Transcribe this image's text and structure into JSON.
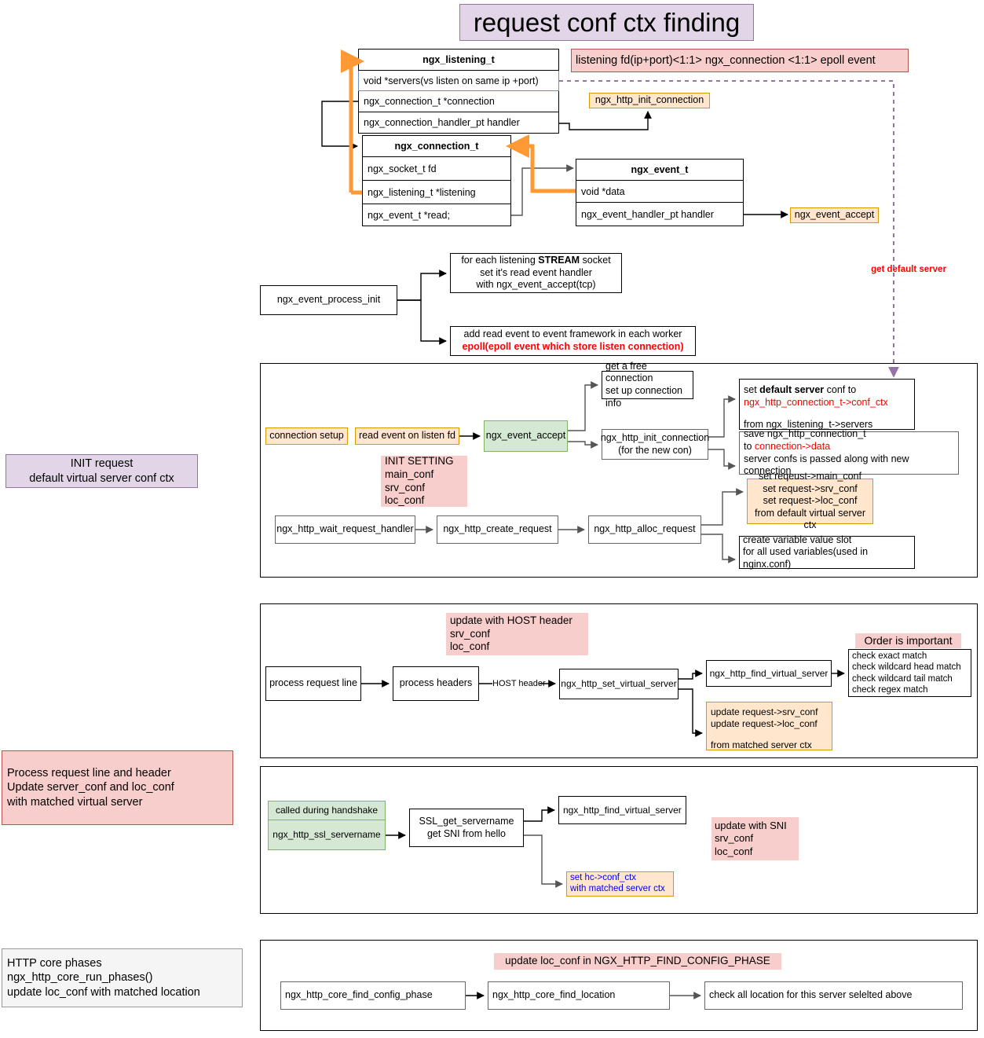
{
  "title": "request conf ctx finding",
  "banners": {
    "listening_relation": "listening fd(ip+port)<1:1> ngx_connection <1:1> epoll event",
    "get_default_server": "get default server"
  },
  "structs": [
    {
      "name": "ngx_listening_t",
      "fields": [
        "void      *servers(vs listen on same ip +port)",
        "ngx_connection_t   *connection",
        "ngx_connection_handler_pt   handler"
      ]
    },
    {
      "name": "ngx_connection_t",
      "fields": [
        "ngx_socket_t        fd",
        "ngx_listening_t   *listening",
        "ngx_event_t        *read;"
      ]
    },
    {
      "name": "ngx_event_t",
      "fields": [
        "void             *data",
        "ngx_event_handler_pt  handler"
      ]
    }
  ],
  "top_nodes": {
    "init_connection": "ngx_http_init_connection",
    "event_accept": "ngx_event_accept"
  },
  "event_init": {
    "node": "ngx_event_process_init",
    "branch1_line1": "for each listening ",
    "branch1_bold": "STREAM",
    "branch1_line1b": " socket",
    "branch1_line2": "set it's read event handler",
    "branch1_line3": "with ngx_event_accept(tcp)",
    "branch2_line1": "add read event to event framework in each worker",
    "branch2_line2": "epoll(epoll event which store listen connection)"
  },
  "side_labels": {
    "init": "INIT request\ndefault virtual server conf ctx",
    "process": "Process request line and header\nUpdate server_conf and loc_conf\nwith matched virtual server",
    "core_phases": "HTTP core phases\nngx_http_core_run_phases()\nupdate loc_conf with matched location"
  },
  "section_init": {
    "connection_setup": "connection setup",
    "read_event": "read event on listen fd",
    "event_accept": "ngx_event_accept",
    "free_conn_l1": "get a free connection",
    "free_conn_l2": "set up connection info",
    "init_conn_l1": "ngx_http_init_connection",
    "init_conn_l2": "(for the new con)",
    "default_conf_l1a": "set ",
    "default_conf_b1": "default",
    "default_conf_l1b": " ",
    "default_conf_b2": "server",
    "default_conf_l1c": " conf to",
    "default_conf_l2": "ngx_http_connection_t->conf_ctx",
    "default_conf_l3": "from ngx_listening_t->servers",
    "save_l1": "save ngx_http_connection_t",
    "save_l2a": "to ",
    "save_l2b": "connection->data",
    "save_l3": "server confs is passed along with new connection",
    "init_setting": "INIT SETTING\nmain_conf\nsrv_conf\nloc_conf",
    "wait_handler": "ngx_http_wait_request_handler",
    "create_request": "ngx_http_create_request",
    "alloc_request": "ngx_http_alloc_request",
    "set_conf_l1": "set reqeust->main_conf",
    "set_conf_l2": "set request->srv_conf",
    "set_conf_l3": "set request->loc_conf",
    "set_conf_l4": "from default virtual server ctx",
    "varslot_l1": "create variable value slot",
    "varslot_l2": "for all used variables(used in nginx.conf)"
  },
  "section_process": {
    "note": "update with HOST header\nsrv_conf\nloc_conf",
    "process_request_line": "process request line",
    "process_headers": "process headers",
    "host_header_label": "HOST header",
    "set_virtual_server": "ngx_http_set_virtual_server",
    "find_virtual_server": "ngx_http_find_virtual_server",
    "order_note": "Order is important",
    "checks": [
      "check exact match",
      "check wildcard head match",
      "check wildcard tail match",
      "check regex match"
    ],
    "update_l1": "update request->srv_conf",
    "update_l2": "update request->loc_conf",
    "update_l3": "from matched server ctx"
  },
  "section_ssl": {
    "handshake_label": "called during handshake",
    "ssl_servername": "ngx_http_ssl_servername",
    "get_servername_l1": "SSL_get_servername",
    "get_servername_l2": "get SNI from hello",
    "find_virtual_server": "ngx_http_find_virtual_server",
    "sni_note": "update with SNI\nsrv_conf\nloc_conf",
    "hc_conf_l1": "set hc->conf_ctx",
    "hc_conf_l2": "with matched server ctx"
  },
  "section_phase": {
    "note": "update loc_conf in NGX_HTTP_FIND_CONFIG_PHASE",
    "find_config_phase": "ngx_http_core_find_config_phase",
    "find_location": "ngx_http_core_find_location",
    "check_all": "check all location for this server selelted above"
  },
  "colors": {
    "pink": "#f8cecc",
    "pink_border": "#b85450",
    "orange": "#ffe6cc",
    "orange_border": "#d79b00",
    "green": "#d5e8d4",
    "green_border": "#82b366",
    "purple": "#e1d5e7",
    "purple_border": "#9673a6",
    "blue": "#dae8fc",
    "blue_border": "#6c8ebf",
    "arrow_orange": "#ff9933",
    "red_text": "#ff0000",
    "blue_text": "#0000ff"
  }
}
